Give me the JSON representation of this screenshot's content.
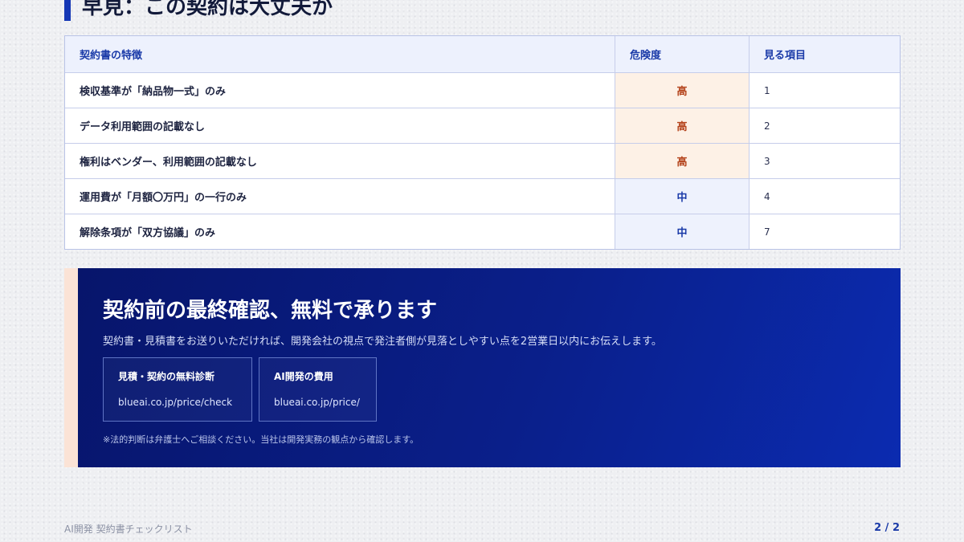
{
  "heading": {
    "title": "早見：この契約は大丈夫か"
  },
  "table": {
    "headers": [
      "契約書の特徴",
      "危険度",
      "見る項目"
    ],
    "rows": [
      {
        "feature": "検収基準が「納品物一式」のみ",
        "risk": "高",
        "item": "1"
      },
      {
        "feature": "データ利用範囲の記載なし",
        "risk": "高",
        "item": "2"
      },
      {
        "feature": "権利はベンダー、利用範囲の記載なし",
        "risk": "高",
        "item": "3"
      },
      {
        "feature": "運用費が「月額〇万円」の一行のみ",
        "risk": "中",
        "item": "4"
      },
      {
        "feature": "解除条項が「双方協議」のみ",
        "risk": "中",
        "item": "7"
      }
    ],
    "colors": {
      "high_bg": "#fdf1e6",
      "high_text": "#b4431b",
      "mid_bg": "#eef2fd",
      "mid_text": "#1a3aa8"
    }
  },
  "cta": {
    "title": "契約前の最終確認、無料で承ります",
    "description": "契約書・見積書をお送りいただければ、開発会社の視点で発注者側が見落としやすい点を2営業日以内にお伝えします。",
    "links": [
      {
        "label": "見積・契約の無料診断",
        "url": "blueai.co.jp/price/check"
      },
      {
        "label": "AI開発の費用",
        "url": "blueai.co.jp/price/"
      }
    ],
    "note": "※法的判断は弁護士へご相談ください。当社は開発実務の観点から確認します。",
    "colors": {
      "background": "#0a1f8a",
      "accent": "#fbe3d6"
    }
  },
  "footer": {
    "left": "AI開発 契約書チェックリスト",
    "page": "2 / 2"
  }
}
